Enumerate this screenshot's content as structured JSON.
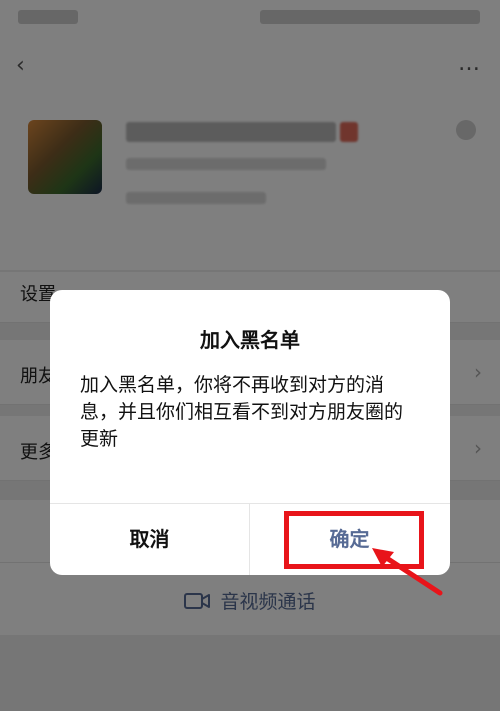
{
  "underlying_page": {
    "row_remark_label": "设置",
    "row_moments_label": "朋友",
    "row_more_label": "更多",
    "chevron": "›",
    "back": "‹",
    "more": "…",
    "call_label": "音视频通话"
  },
  "dialog": {
    "title": "加入黑名单",
    "message": "加入黑名单，你将不再收到对方的消息，并且你们相互看不到对方朋友圈的更新",
    "cancel_label": "取消",
    "confirm_label": "确定"
  },
  "colors": {
    "link_blue": "#576b95",
    "highlight_red": "#e8141a",
    "mask": "rgba(0,0,0,0.5)"
  }
}
